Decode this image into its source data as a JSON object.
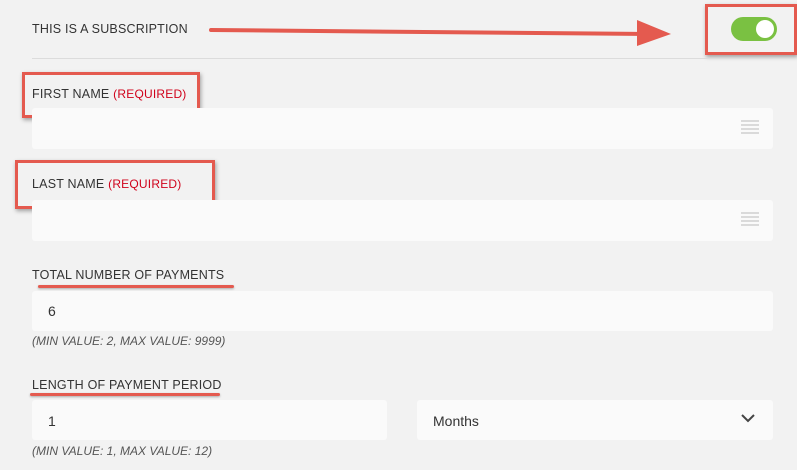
{
  "subscription": {
    "label": "THIS IS A SUBSCRIPTION",
    "toggle_on": true,
    "toggle_color": "#7ac142"
  },
  "first_name": {
    "label": "FIRST NAME",
    "required": "(REQUIRED)",
    "value": "",
    "icon": "contact-card-icon"
  },
  "last_name": {
    "label": "LAST NAME",
    "required": "(REQUIRED)",
    "value": "",
    "icon": "contact-card-icon"
  },
  "total_payments": {
    "label": "TOTAL NUMBER OF PAYMENTS",
    "value": "6",
    "helper": "(MIN VALUE: 2, MAX VALUE: 9999)"
  },
  "payment_period": {
    "label": "LENGTH OF PAYMENT PERIOD",
    "value": "1",
    "unit": "Months",
    "helper": "(MIN VALUE: 1, MAX VALUE: 12)"
  },
  "annotation_color": "#e45a4f",
  "required_color": "#d0021b"
}
